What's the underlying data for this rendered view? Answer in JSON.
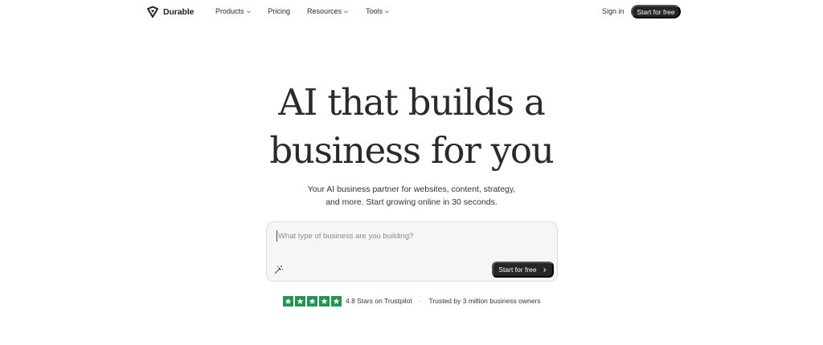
{
  "nav": {
    "brand": "Durable",
    "links": [
      {
        "label": "Products",
        "has_dropdown": true
      },
      {
        "label": "Pricing",
        "has_dropdown": false
      },
      {
        "label": "Resources",
        "has_dropdown": true
      },
      {
        "label": "Tools",
        "has_dropdown": true
      }
    ],
    "sign_in": "Sign in",
    "cta": "Start for free"
  },
  "hero": {
    "title_line1": "AI that builds a",
    "title_line2": "business for you",
    "subtitle_line1": "Your AI business partner for websites, content, strategy,",
    "subtitle_line2": "and more. Start growing online in 30 seconds."
  },
  "prompt": {
    "placeholder": "What type of business are you building?",
    "value": "",
    "cta": "Start for free",
    "wand_icon": "magic-wand-icon",
    "arrow_icon": "chevron-right-icon"
  },
  "trust": {
    "rating_stars": 5,
    "rating_text": "4.8 Stars on Trustpilot",
    "separator": "·",
    "trusted_text": "Trusted by 3 million business owners"
  },
  "colors": {
    "primary_button": "#262626",
    "star_green": "#219653",
    "text": "#1f1f1f",
    "input_bg": "#f6f6f6"
  }
}
